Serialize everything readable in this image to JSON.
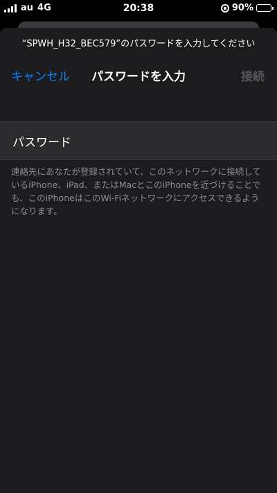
{
  "status_bar": {
    "carrier": "au",
    "network": "4G",
    "time": "20:38",
    "battery_percent": "90%",
    "battery_level": 0.9,
    "icons": [
      "signal-bars-icon",
      "rotation-lock-icon",
      "battery-icon"
    ]
  },
  "sheet": {
    "prompt": "“SPWH_H32_BEC579”のパスワードを入力してください",
    "nav": {
      "cancel_label": "キャンセル",
      "title": "パスワードを入力",
      "connect_label": "接続"
    },
    "password_field": {
      "label": "パスワード",
      "value": "",
      "placeholder": ""
    },
    "footer_note": "連絡先にあなたが登録されていて、このネットワークに接続しているiPhone、iPad、またはMacとこのiPhoneを近づけることでも、このiPhoneはこのWi-Fiネットワークにアクセスできるようになります。"
  },
  "colors": {
    "accent": "#0a84ff",
    "disabled": "#545456",
    "background": "#1c1c1e",
    "row_background": "#2c2c2e",
    "secondary_text": "#8e8e93"
  }
}
